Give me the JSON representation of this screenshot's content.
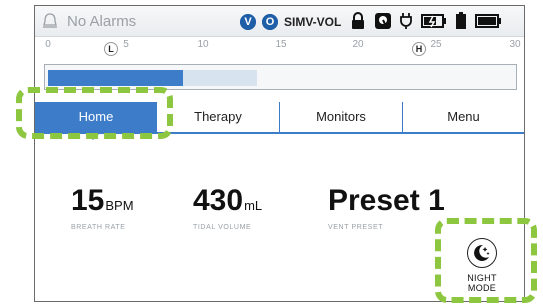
{
  "status": {
    "alarm_text": "No Alarms",
    "badges": [
      "V",
      "O"
    ],
    "mode": "SIMV-VOL",
    "accent_color": "#1f5fa8"
  },
  "ruler": {
    "ticks": [
      "0",
      "5",
      "10",
      "15",
      "20",
      "25",
      "30"
    ],
    "markers": [
      "L",
      "H"
    ]
  },
  "gauge": {
    "value_fraction": 0.29,
    "preview_fraction": 0.45,
    "fill_color": "#3d7cc9"
  },
  "tabs": [
    {
      "label": "Home",
      "active": true
    },
    {
      "label": "Therapy",
      "active": false
    },
    {
      "label": "Monitors",
      "active": false
    },
    {
      "label": "Menu",
      "active": false
    }
  ],
  "readouts": {
    "breath_rate": {
      "value": "15",
      "unit": "BPM",
      "label": "BREATH RATE"
    },
    "tidal_volume": {
      "value": "430",
      "unit": "mL",
      "label": "TIDAL VOLUME"
    },
    "vent_preset": {
      "value": "Preset 1",
      "label": "VENT PRESET"
    }
  },
  "night_mode": {
    "label": "NIGHT MODE",
    "icon": "moon-stars-icon"
  },
  "highlight_color": "#8dc63f"
}
